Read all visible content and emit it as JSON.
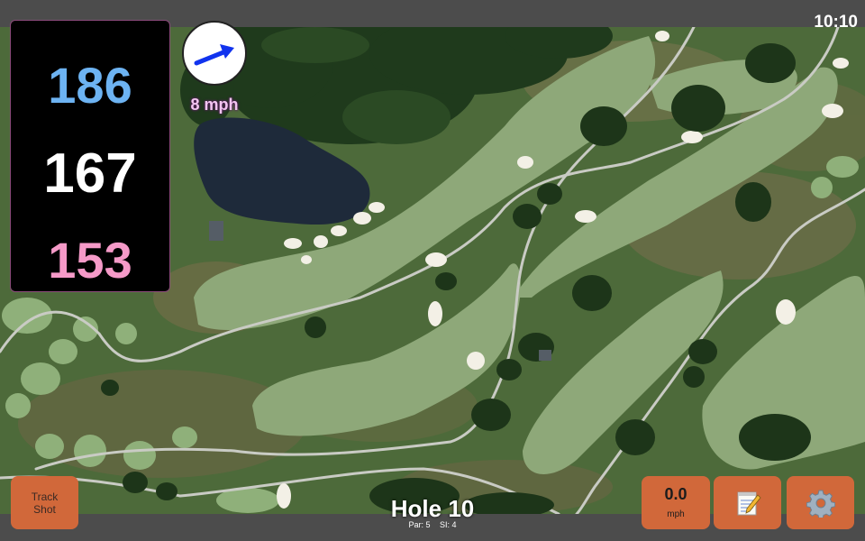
{
  "status_bar": {
    "time": "10:10"
  },
  "distances": {
    "back": "186",
    "middle": "167",
    "front": "153"
  },
  "wind": {
    "speed": "8 mph",
    "icon": "arrow-icon"
  },
  "hole": {
    "title": "Hole 10",
    "par": "Par: 5",
    "si": "SI: 4"
  },
  "buttons": {
    "track_line1": "Track",
    "track_line2": "Shot",
    "speed_value": "0.0",
    "speed_unit": "mph",
    "notes_icon": "notepad-icon",
    "settings_icon": "gear-icon"
  },
  "colors": {
    "back_distance": "#6db3f2",
    "middle_distance": "#ffffff",
    "front_distance": "#f59ac8",
    "button": "#d1683a",
    "fairway": "#8ea879",
    "rough": "#4d6a3a"
  }
}
